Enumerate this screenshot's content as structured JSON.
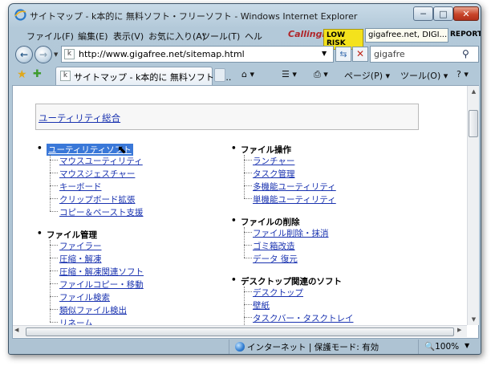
{
  "window": {
    "title": "サイトマップ - k本的に 無料ソフト・フリーソフト - Windows Internet Explorer"
  },
  "controls": {
    "minimize": "─",
    "maximize": "□",
    "close": "✕"
  },
  "menu": {
    "items": [
      "ファイル(F)",
      "編集(E)",
      "表示(V)",
      "お気に入り(A)",
      "ツール(T)",
      "ヘル"
    ],
    "callingid_logo": "CallingID",
    "risk_badge": "LOW RISK",
    "site_box": "gigafree.net, DIGI...",
    "report": "REPORT▾"
  },
  "nav": {
    "back": "←",
    "forward": "→",
    "url": "http://www.gigafree.net/sitemap.html",
    "favicon": "k",
    "go": "⇆",
    "stop": "✕",
    "search_value": "gigafre",
    "search_icon": "⚲"
  },
  "tabbar": {
    "tab_label": "サイトマップ - k本的に 無料ソフト・...",
    "tab_favicon": "k",
    "commands": [
      "⌂ ▾",
      "☰ ▾",
      "⎙ ▾",
      "ページ(P) ▾",
      "ツール(O) ▾",
      "? ▾"
    ]
  },
  "page": {
    "section_title": "ユーティリティ総合",
    "left_col": [
      {
        "heading": "ユーティリティソフト",
        "selected": true,
        "items": [
          "マウスユーティリティ",
          "マウスジェスチャー",
          "キーボード",
          "クリップボード拡張",
          "コピー＆ペースト支援"
        ]
      },
      {
        "heading": "ファイル管理",
        "selected": false,
        "items": [
          "ファイラー",
          "圧縮・解凍",
          "圧縮・解凍関連ソフト",
          "ファイルコピー・移動",
          "ファイル検索",
          "類似ファイル検出",
          "リネーム"
        ]
      }
    ],
    "right_col": [
      {
        "heading": "ファイル操作",
        "items": [
          "ランチャー",
          "タスク管理",
          "多機能ユーティリティ",
          "単機能ユーティリティ"
        ]
      },
      {
        "heading": "ファイルの削除",
        "items": [
          "ファイル削除・抹消",
          "ゴミ箱改造",
          "データ 復元"
        ]
      },
      {
        "heading": "デスクトップ関連のソフト",
        "items": [
          "デスクトップ",
          "壁紙",
          "タスクバー・タスクトレイ"
        ]
      }
    ]
  },
  "status": {
    "zone": "インターネット | 保護モード: 有効",
    "zoom": "100%"
  },
  "colors": {
    "link": "#1a33b0",
    "selection": "#3a78d8",
    "risk": "#f4e21c"
  }
}
